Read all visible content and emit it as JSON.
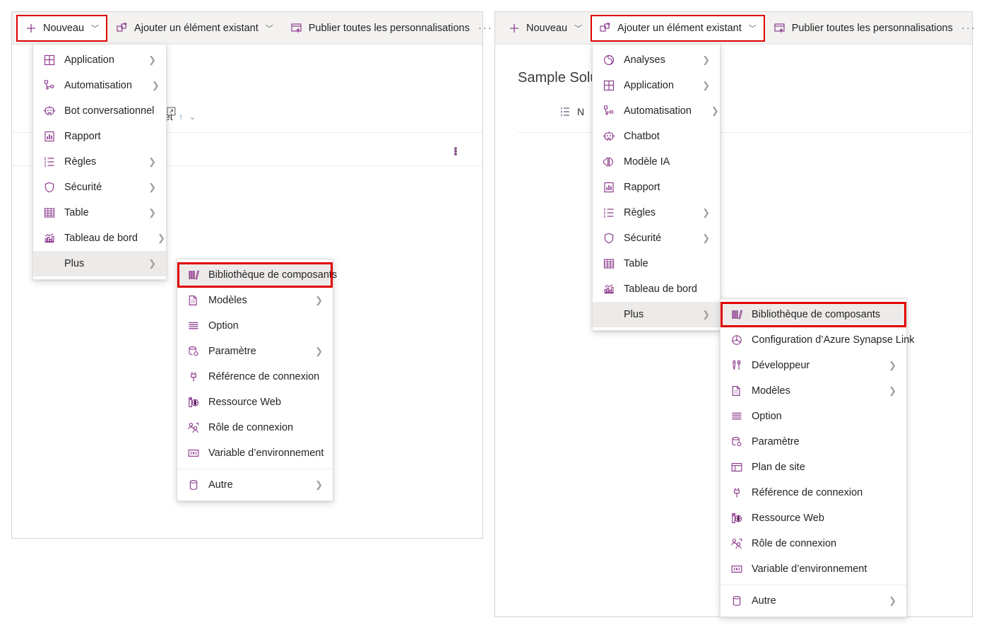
{
  "toolbar": {
    "new_label": "Nouveau",
    "add_existing_label": "Ajouter un élément existant",
    "publish_label": "Publier toutes les personnalisations",
    "overflow_label": "···"
  },
  "background_left": {
    "column_header_fragment": "et",
    "sort_arrow": "↑",
    "chevron": "⌄",
    "row_overflow": "⋮"
  },
  "background_right": {
    "solution_title": "Sample Solu",
    "list_label_fragment": "N"
  },
  "left_panel": {
    "new_menu": [
      {
        "label": "Application",
        "icon": "application-icon",
        "submenu": true,
        "external": false
      },
      {
        "label": "Automatisation",
        "icon": "automation-icon",
        "submenu": true,
        "external": false
      },
      {
        "label": "Bot conversationnel",
        "icon": "chatbot-icon",
        "submenu": false,
        "external": true
      },
      {
        "label": "Rapport",
        "icon": "report-icon",
        "submenu": false,
        "external": false
      },
      {
        "label": "Règles",
        "icon": "rules-icon",
        "submenu": true,
        "external": false
      },
      {
        "label": "Sécurité",
        "icon": "security-icon",
        "submenu": true,
        "external": false
      },
      {
        "label": "Table",
        "icon": "table-icon",
        "submenu": true,
        "external": false
      },
      {
        "label": "Tableau de bord",
        "icon": "dashboard-icon",
        "submenu": true,
        "external": false
      },
      {
        "label": "Plus",
        "icon": "none",
        "submenu": true,
        "external": false,
        "selected": true
      }
    ],
    "more_submenu": [
      {
        "label": "Bibliothèque de composants",
        "icon": "component-library-icon",
        "submenu": false,
        "highlighted": true
      },
      {
        "label": "Modèles",
        "icon": "templates-icon",
        "submenu": true
      },
      {
        "label": "Option",
        "icon": "option-icon",
        "submenu": false
      },
      {
        "label": "Paramètre",
        "icon": "setting-icon",
        "submenu": true
      },
      {
        "label": "Référence de connexion",
        "icon": "connection-ref-icon",
        "submenu": false
      },
      {
        "label": "Ressource Web",
        "icon": "web-resource-icon",
        "submenu": false
      },
      {
        "label": "Rôle de connexion",
        "icon": "connection-role-icon",
        "submenu": false
      },
      {
        "label": "Variable d’environnement",
        "icon": "env-variable-icon",
        "submenu": false
      },
      {
        "label": "Autre",
        "icon": "other-icon",
        "submenu": true,
        "divider_before": true
      }
    ]
  },
  "right_panel": {
    "add_existing_menu": [
      {
        "label": "Analyses",
        "icon": "analytics-icon",
        "submenu": true
      },
      {
        "label": "Application",
        "icon": "application-icon",
        "submenu": true
      },
      {
        "label": "Automatisation",
        "icon": "automation-icon",
        "submenu": true
      },
      {
        "label": "Chatbot",
        "icon": "chatbot-icon",
        "submenu": false
      },
      {
        "label": "Modèle IA",
        "icon": "ai-model-icon",
        "submenu": false
      },
      {
        "label": "Rapport",
        "icon": "report-icon",
        "submenu": false
      },
      {
        "label": "Règles",
        "icon": "rules-icon",
        "submenu": true
      },
      {
        "label": "Sécurité",
        "icon": "security-icon",
        "submenu": true
      },
      {
        "label": "Table",
        "icon": "table-icon",
        "submenu": false
      },
      {
        "label": "Tableau de bord",
        "icon": "dashboard-icon",
        "submenu": false
      },
      {
        "label": "Plus",
        "icon": "none",
        "submenu": true,
        "selected": true
      }
    ],
    "more_submenu": [
      {
        "label": "Bibliothèque de composants",
        "icon": "component-library-icon",
        "submenu": false,
        "highlighted": true
      },
      {
        "label": "Configuration d’Azure Synapse Link",
        "icon": "synapse-link-icon",
        "submenu": false
      },
      {
        "label": "Développeur",
        "icon": "developer-icon",
        "submenu": true
      },
      {
        "label": "Modèles",
        "icon": "templates-icon",
        "submenu": true
      },
      {
        "label": "Option",
        "icon": "option-icon",
        "submenu": false
      },
      {
        "label": "Paramètre",
        "icon": "setting-icon",
        "submenu": false
      },
      {
        "label": "Plan de site",
        "icon": "sitemap-icon",
        "submenu": false
      },
      {
        "label": "Référence de connexion",
        "icon": "connection-ref-icon",
        "submenu": false
      },
      {
        "label": "Ressource Web",
        "icon": "web-resource-icon",
        "submenu": false
      },
      {
        "label": "Rôle de connexion",
        "icon": "connection-role-icon",
        "submenu": false
      },
      {
        "label": "Variable d’environnement",
        "icon": "env-variable-icon",
        "submenu": false
      },
      {
        "label": "Autre",
        "icon": "other-icon",
        "submenu": true,
        "divider_before": true
      }
    ]
  },
  "colors": {
    "icon_purple": "#8f3f8f",
    "annotation_red": "#e00000",
    "toolbar_bg": "#f3f2f1",
    "selected_bg": "#edebe9"
  }
}
